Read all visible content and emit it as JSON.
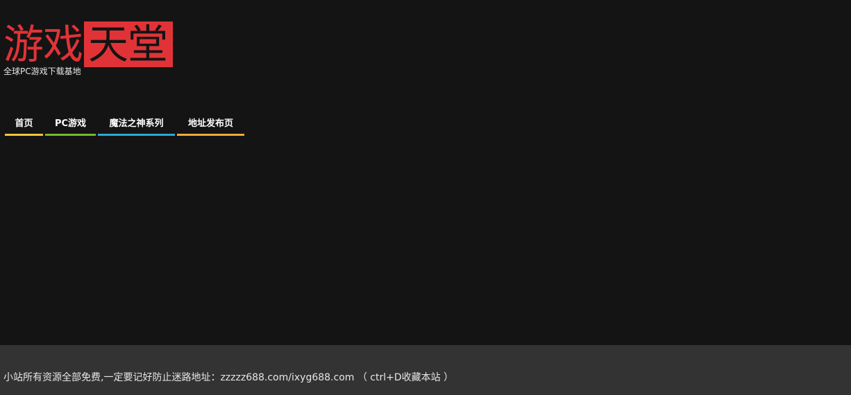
{
  "header": {
    "logo_part1": "游戏",
    "logo_part2": "天堂",
    "tagline": "全球PC游戏下载基地"
  },
  "nav": {
    "items": [
      {
        "label": "首页",
        "color": "#f2c63a"
      },
      {
        "label": "PC游戏",
        "color": "#7ab829"
      },
      {
        "label": "魔法之神系列",
        "color": "#2ba9d6"
      },
      {
        "label": "地址发布页",
        "color": "#f5a937"
      }
    ]
  },
  "footer": {
    "text": "小站所有资源全部免费,一定要记好防止迷路地址：zzzzz688.com/ixyg688.com （ ctrl+D收藏本站 ）"
  },
  "colors": {
    "background": "#141414",
    "accent": "#e13337",
    "footer_bg": "#333333"
  }
}
